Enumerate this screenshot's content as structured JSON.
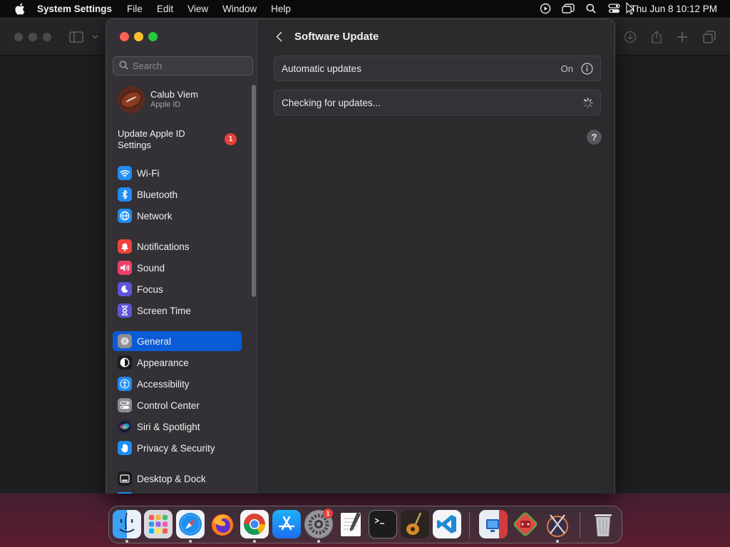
{
  "menubar": {
    "app_name": "System Settings",
    "menus": [
      "File",
      "Edit",
      "View",
      "Window",
      "Help"
    ],
    "clock": "Thu Jun 8  10:12 PM"
  },
  "sidebar": {
    "search_placeholder": "Search",
    "profile": {
      "name": "Calub Viem",
      "subtitle": "Apple ID"
    },
    "update_row": {
      "label": "Update Apple ID Settings",
      "badge": "1"
    },
    "items": [
      {
        "label": "Wi-Fi",
        "icon": "wifi-icon",
        "color": "#1f8cf3"
      },
      {
        "label": "Bluetooth",
        "icon": "bluetooth-icon",
        "color": "#1f8cf3"
      },
      {
        "label": "Network",
        "icon": "globe-icon",
        "color": "#1f8cf3"
      },
      {
        "label": "Notifications",
        "icon": "bell-icon",
        "color": "#f0433a"
      },
      {
        "label": "Sound",
        "icon": "speaker-icon",
        "color": "#ef3e67"
      },
      {
        "label": "Focus",
        "icon": "moon-icon",
        "color": "#5f55d8"
      },
      {
        "label": "Screen Time",
        "icon": "hourglass-icon",
        "color": "#5f55d8"
      },
      {
        "label": "General",
        "icon": "gear-icon",
        "color": "#8e8d93",
        "active": true
      },
      {
        "label": "Appearance",
        "icon": "appearance-icon",
        "color": "#1c1c1e"
      },
      {
        "label": "Accessibility",
        "icon": "accessibility-icon",
        "color": "#1f8cf3"
      },
      {
        "label": "Control Center",
        "icon": "control-center-icon",
        "color": "#8e8d93"
      },
      {
        "label": "Siri & Spotlight",
        "icon": "siri-icon",
        "color": "#2a2a4a"
      },
      {
        "label": "Privacy & Security",
        "icon": "hand-icon",
        "color": "#1f8cf3"
      },
      {
        "label": "Desktop & Dock",
        "icon": "dock-icon",
        "color": "#1c1c1e"
      }
    ]
  },
  "content": {
    "title": "Software Update",
    "automatic_updates": {
      "label": "Automatic updates",
      "value": "On"
    },
    "checking": {
      "label": "Checking for updates..."
    },
    "help": "?"
  },
  "dock": {
    "apps": [
      "finder",
      "launchpad",
      "safari",
      "firefox",
      "chrome",
      "app-store",
      "system-settings",
      "textedit",
      "terminal",
      "garageband",
      "vscode",
      "remote-desktop",
      "app-red",
      "instruments",
      "trash"
    ],
    "system_settings_badge": "1"
  }
}
